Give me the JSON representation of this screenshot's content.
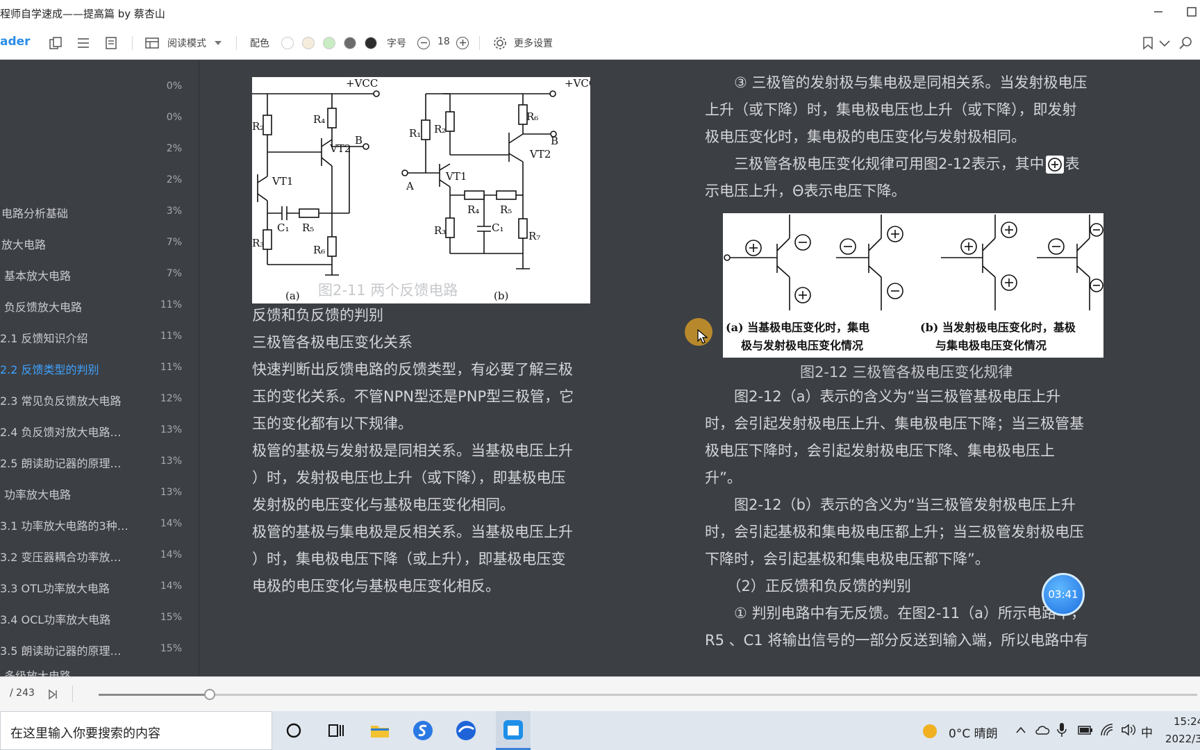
{
  "window": {
    "title": "程师自学速成——提高篇 by 蔡杏山"
  },
  "toolbar": {
    "app_name": "ader",
    "reading_mode": "阅读模式",
    "color_label": "配色",
    "font_label": "字号",
    "font_size": "18",
    "more_settings": "更多设置",
    "swatch_colors": [
      "#ffffff",
      "#f5ecdc",
      "#c9ecc4",
      "#6b6b6b",
      "#2d2d2d"
    ]
  },
  "sidebar": {
    "items": [
      {
        "label": "",
        "pct": "0%"
      },
      {
        "label": "",
        "pct": "0%"
      },
      {
        "label": "",
        "pct": "2%"
      },
      {
        "label": "",
        "pct": "2%"
      },
      {
        "label": "电路分析基础",
        "pct": "3%"
      },
      {
        "label": "放大电路",
        "pct": "7%"
      },
      {
        "label": "基本放大电路",
        "pct": "7%"
      },
      {
        "label": "负反馈放大电路",
        "pct": "11%"
      },
      {
        "label": "2.1   反馈知识介绍",
        "pct": "11%"
      },
      {
        "label": "2.2   反馈类型的判别",
        "pct": "11%"
      },
      {
        "label": "2.3   常见负反馈放大电路",
        "pct": "12%"
      },
      {
        "label": "2.4   负反馈对放大电路…",
        "pct": "13%"
      },
      {
        "label": "2.5   朗读助记器的原理…",
        "pct": "13%"
      },
      {
        "label": "功率放大电路",
        "pct": "13%"
      },
      {
        "label": "3.1   功率放大电路的3种…",
        "pct": "14%"
      },
      {
        "label": "3.2   变压器耦合功率放…",
        "pct": "14%"
      },
      {
        "label": "3.3   OTL功率放大电路",
        "pct": "14%"
      },
      {
        "label": "3.4   OCL功率放大电路",
        "pct": "15%"
      },
      {
        "label": "3.5   朗读助记器的原理…",
        "pct": "15%"
      },
      {
        "label": "多级放大电路",
        "pct": ""
      }
    ]
  },
  "content": {
    "fig11_caption": "图2-11 两个反馈电路",
    "fig11_labels": {
      "vcc": "+VCC",
      "a": "(a)",
      "b": "(b)",
      "vt1": "VT1",
      "vt2": "VT2",
      "B": "B",
      "A": "A"
    },
    "left_paras": [
      "反馈和负反馈的判别",
      " 三极管各极电压变化关系",
      "快速判断出反馈电路的反馈类型，有必要了解三极",
      "玉的变化关系。不管NPN型还是PNP型三极管，它",
      "玉的变化都有以下规律。",
      "极管的基极与发射极是同相关系。当基极电压上升",
      "）时，发射极电压也上升（或下降），即基极电压",
      "发射极的电压变化与基极电压变化相同。",
      "极管的基极与集电极是反相关系。当基极电压上升",
      "）时，集电极电压下降（或上升），即基极电压变",
      "电极的电压变化与基极电压变化相反。"
    ],
    "right_top_paras": [
      "　　③ 三极管的发射极与集电极是同相关系。当发射极电压",
      "上升（或下降）时，集电极电压也上升（或下降），即发射",
      "极电压变化时，集电极的电压变化与发射极相同。"
    ],
    "right_para4_before": "　　三极管各极电压变化规律可用图2-12表示，其中",
    "right_para4_after": "表",
    "right_para5": "示电压上升，Θ表示电压下降。",
    "fig12_caption": "图2-12 三极管各极电压变化规律",
    "fig12_label_a_1": "(a) 当基极电压变化时，集电",
    "fig12_label_a_2": "极与发射极电压变化情况",
    "fig12_label_b_1": "(b) 当发射极电压变化时，基极",
    "fig12_label_b_2": "与集电极电压变化情况",
    "right_bottom_paras": [
      "　　图2-12（a）表示的含义为“当三极管基极电压上升",
      "时，会引起发射极电压上升、集电极电压下降；当三极管基",
      "极电压下降时，会引起发射极电压下降、集电极电压上",
      "升”。",
      "　　图2-12（b）表示的含义为“当三极管发射极电压上升",
      "时，会引起基极和集电极电压都上升；当三极管发射极电压",
      "下降时，会引起基极和集电极电压都下降”。",
      "　　（2）正反馈和负反馈的判别",
      "　　① 判别电路中有无反馈。在图2-11（a）所示电路中，",
      "R5 、C1 将输出信号的一部分反送到输入端，所以电路中有"
    ],
    "timer": "03:41"
  },
  "bottombar": {
    "page_info": "/ 243",
    "progress": 0.101
  },
  "taskbar": {
    "search_placeholder": "在这里输入你要搜索的内容",
    "weather": "0°C  晴朗",
    "ime": "中",
    "time": "15:24",
    "date": "2022/3"
  }
}
